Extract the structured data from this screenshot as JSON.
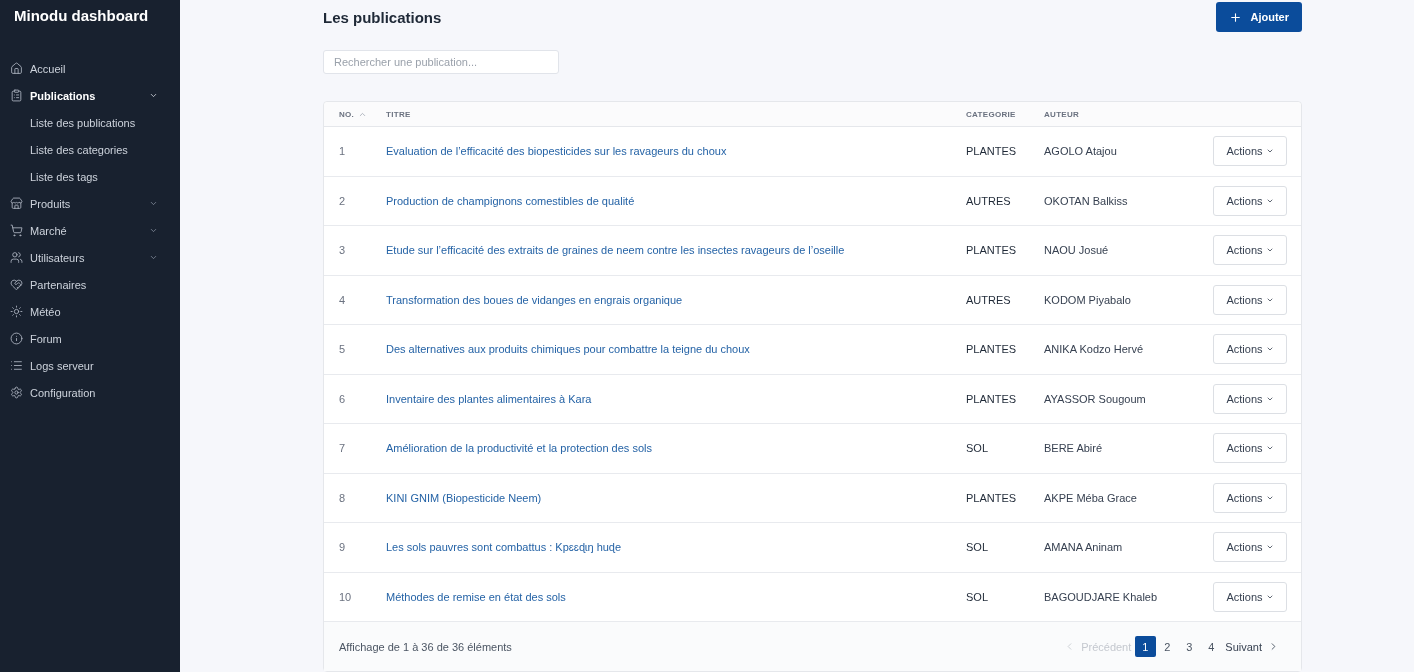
{
  "sidebar": {
    "title": "Minodu dashboard",
    "items": [
      {
        "label": "Accueil",
        "kind": "link",
        "selected": false
      },
      {
        "label": "Publications",
        "kind": "group",
        "selected": true,
        "expanded": true,
        "children": [
          {
            "label": "Liste des publications",
            "selected": false
          },
          {
            "label": "Liste des categories",
            "selected": false
          },
          {
            "label": "Liste des tags",
            "selected": false
          }
        ]
      },
      {
        "label": "Produits",
        "kind": "group",
        "selected": false,
        "expanded": false
      },
      {
        "label": "Marché",
        "kind": "group",
        "selected": false,
        "expanded": false
      },
      {
        "label": "Utilisateurs",
        "kind": "group",
        "selected": false,
        "expanded": false
      },
      {
        "label": "Partenaires",
        "kind": "link",
        "selected": false
      },
      {
        "label": "Météo",
        "kind": "link",
        "selected": false
      },
      {
        "label": "Forum",
        "kind": "link",
        "selected": false
      },
      {
        "label": "Logs serveur",
        "kind": "link",
        "selected": false
      },
      {
        "label": "Configuration",
        "kind": "link",
        "selected": false
      }
    ]
  },
  "header": {
    "title": "Les publications",
    "add_button": "Ajouter"
  },
  "search": {
    "placeholder": "Rechercher une publication..."
  },
  "table": {
    "columns": [
      {
        "label": "NO.",
        "sorted": true
      },
      {
        "label": "TITRE",
        "sorted": false
      },
      {
        "label": "CATEGORIE",
        "sorted": false
      },
      {
        "label": "AUTEUR",
        "sorted": false
      }
    ],
    "rows": [
      {
        "no": "1",
        "title": "Evaluation de l’efficacité des biopesticides sur les ravageurs du choux",
        "category": "PLANTES",
        "author": "AGOLO Atajou",
        "action": "Actions"
      },
      {
        "no": "2",
        "title": "Production de champignons comestibles de qualité",
        "category": "AUTRES",
        "author": "OKOTAN Balkiss",
        "action": "Actions"
      },
      {
        "no": "3",
        "title": "Etude sur l’efficacité des extraits de graines de neem contre les insectes ravageurs de l’oseille",
        "category": "PLANTES",
        "author": "NAOU Josué",
        "action": "Actions"
      },
      {
        "no": "4",
        "title": "Transformation des boues de vidanges en engrais organique",
        "category": "AUTRES",
        "author": "KODOM Piyabalo",
        "action": "Actions"
      },
      {
        "no": "5",
        "title": "Des alternatives aux produits chimiques pour combattre la teigne du choux",
        "category": "PLANTES",
        "author": "ANIKA Kodzo Hervé",
        "action": "Actions"
      },
      {
        "no": "6",
        "title": "Inventaire des plantes alimentaires à Kara",
        "category": "PLANTES",
        "author": "AYASSOR Sougoum",
        "action": "Actions"
      },
      {
        "no": "7",
        "title": "Amélioration de la productivité et la protection des sols",
        "category": "SOL",
        "author": "BERE Abiré",
        "action": "Actions"
      },
      {
        "no": "8",
        "title": "KINI GNIM (Biopesticide Neem)",
        "category": "PLANTES",
        "author": "AKPE Méba Grace",
        "action": "Actions"
      },
      {
        "no": "9",
        "title": "Les sols pauvres sont combattus : Kpɛɛɖɩŋ huɖe",
        "category": "SOL",
        "author": "AMANA Aninam",
        "action": "Actions"
      },
      {
        "no": "10",
        "title": "Méthodes de remise en état des sols",
        "category": "SOL",
        "author": "BAGOUDJARE Khaleb",
        "action": "Actions"
      }
    ]
  },
  "footer": {
    "summary": "Affichage de 1 à 36 de 36 éléments",
    "pagination": {
      "previous": {
        "label": "Précédent",
        "disabled": true
      },
      "pages": [
        {
          "label": "1",
          "selected": true
        },
        {
          "label": "2",
          "selected": false
        },
        {
          "label": "3",
          "selected": false
        },
        {
          "label": "4",
          "selected": false
        }
      ],
      "next": {
        "label": "Suivant",
        "disabled": false
      }
    }
  }
}
